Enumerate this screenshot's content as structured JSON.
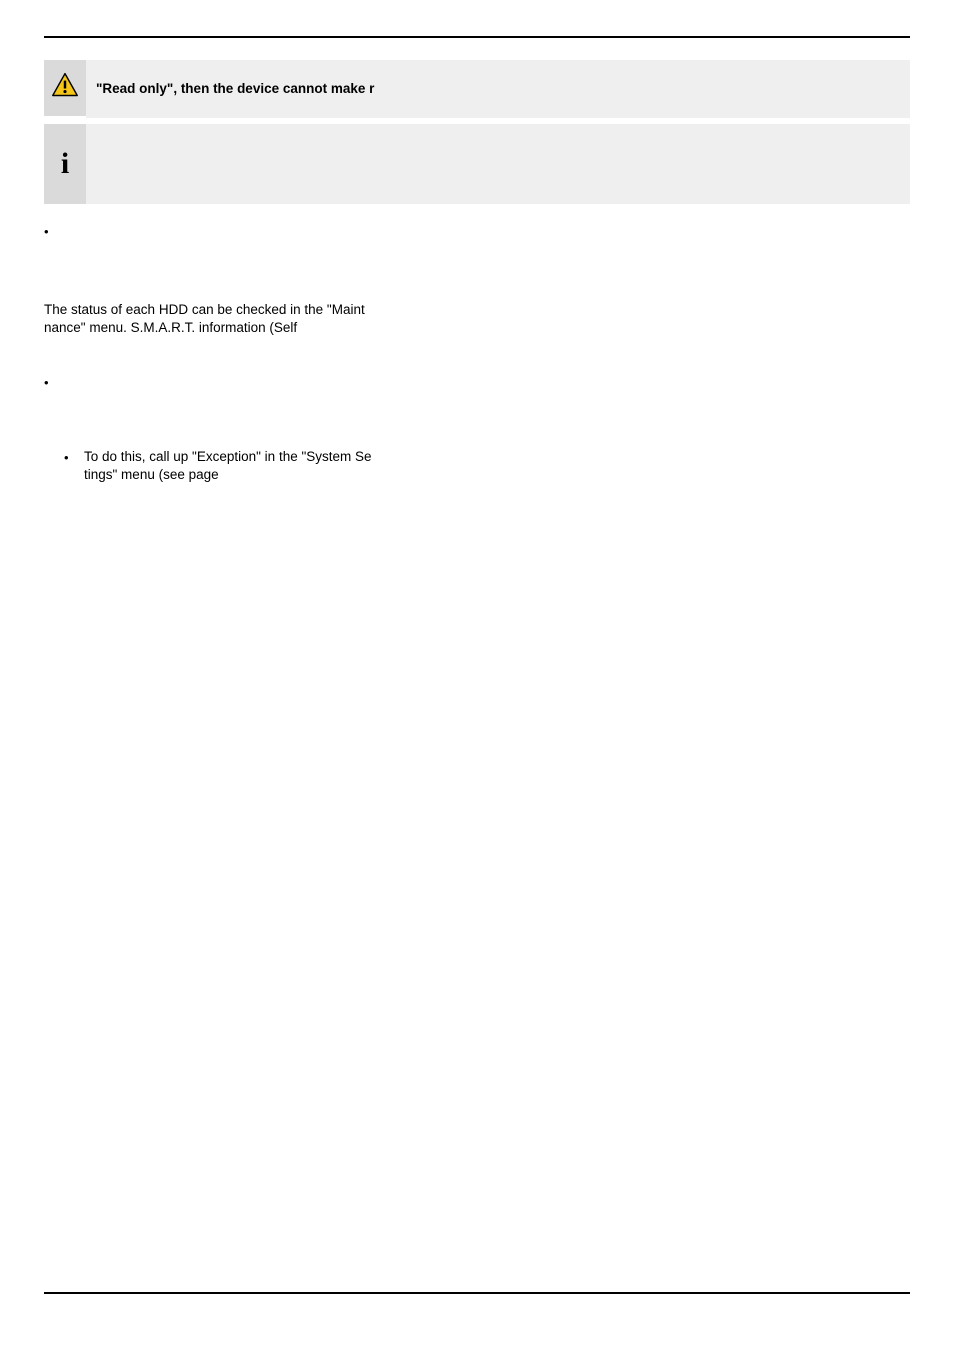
{
  "warning_note": {
    "text": "\"Read only\", then the device cannot make r"
  },
  "info_note": {
    "text": ""
  },
  "bullet1": {
    "text": ""
  },
  "paragraph1": {
    "line1": "The status of each HDD can be checked in the \"Maint",
    "line2": "nance\" menu. S.M.A.R.T. information (Self"
  },
  "bullet2": {
    "text": ""
  },
  "bullet3": {
    "line1": "To do this, call up \"Exception\" in the \"System Se",
    "line2": "tings\" menu (see page"
  }
}
